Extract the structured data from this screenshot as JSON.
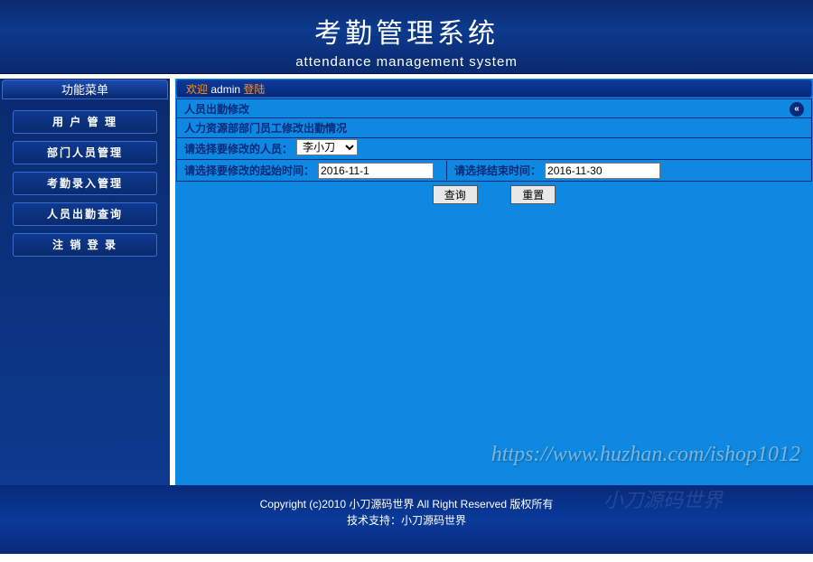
{
  "header": {
    "title": "考勤管理系统",
    "subtitle": "attendance management system"
  },
  "sidebar": {
    "title": "功能菜单",
    "items": [
      {
        "label": "用 户 管 理"
      },
      {
        "label": "部门人员管理"
      },
      {
        "label": "考勤录入管理"
      },
      {
        "label": "人员出勤查询"
      },
      {
        "label": "注 销 登 录"
      }
    ]
  },
  "welcome": {
    "prefix": "欢迎",
    "user": "admin",
    "suffix": "登陆"
  },
  "panel": {
    "section_title": "人员出勤修改",
    "info_line": "人力资源部部门员工修改出勤情况",
    "person_label": "请选择要修改的人员：",
    "person_selected": "李小刀",
    "start_label": "请选择要修改的起始时间：",
    "start_value": "2016-11-1",
    "end_label": "请选择结束时间：",
    "end_value": "2016-11-30",
    "query_btn": "查询",
    "reset_btn": "重置",
    "back_icon": "«"
  },
  "watermark": "https://www.huzhan.com/ishop1012",
  "footer": {
    "line1": "Copyright (c)2010   小刀源码世界   All Right Reserved   版权所有",
    "line2": "技术支持：小刀源码世界",
    "ghost": "小刀源码世界"
  }
}
